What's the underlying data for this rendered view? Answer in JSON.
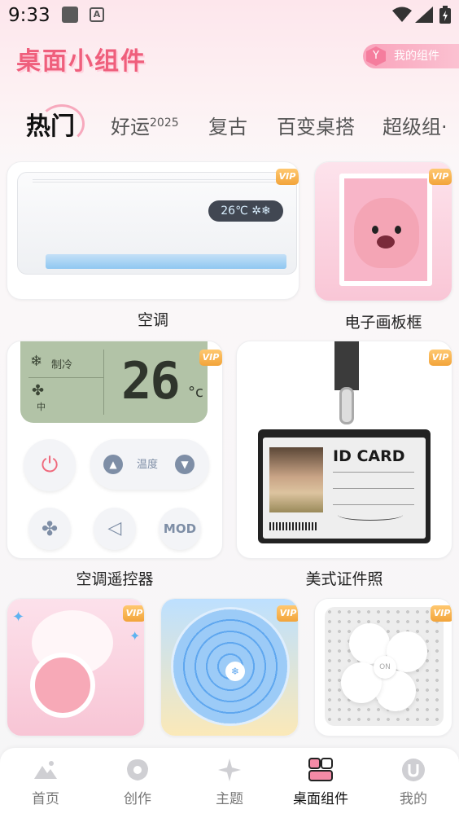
{
  "status_bar": {
    "time": "9:33"
  },
  "header": {
    "title": "桌面小组件",
    "my_widgets_label": "我的组件"
  },
  "tabs": [
    {
      "label": "热门",
      "active": true
    },
    {
      "label": "好运",
      "suffix": "2025"
    },
    {
      "label": "复古"
    },
    {
      "label": "百变桌搭"
    },
    {
      "label": "超级组·"
    }
  ],
  "vip_badge": "VIP",
  "widgets": {
    "ac": {
      "label": "空调",
      "display": "26℃ ✲❄"
    },
    "photo_frame": {
      "label": "电子画板框"
    },
    "remote": {
      "label": "空调遥控器",
      "mode_label": "制冷",
      "fan_label": "中",
      "temp": "26",
      "unit": "°c",
      "temp_button_label": "温度",
      "mod_label": "MOD"
    },
    "id_photo": {
      "label": "美式证件照",
      "card_title": "ID CARD"
    }
  },
  "bottom_nav": [
    {
      "label": "首页",
      "icon": "mountain-icon"
    },
    {
      "label": "创作",
      "icon": "flower-icon"
    },
    {
      "label": "主题",
      "icon": "sparkle-icon"
    },
    {
      "label": "桌面组件",
      "icon": "widgets-icon",
      "active": true
    },
    {
      "label": "我的",
      "icon": "profile-icon"
    }
  ],
  "colors": {
    "brand_pink": "#ef5f7c",
    "vip_gold": "#f2a43a"
  }
}
